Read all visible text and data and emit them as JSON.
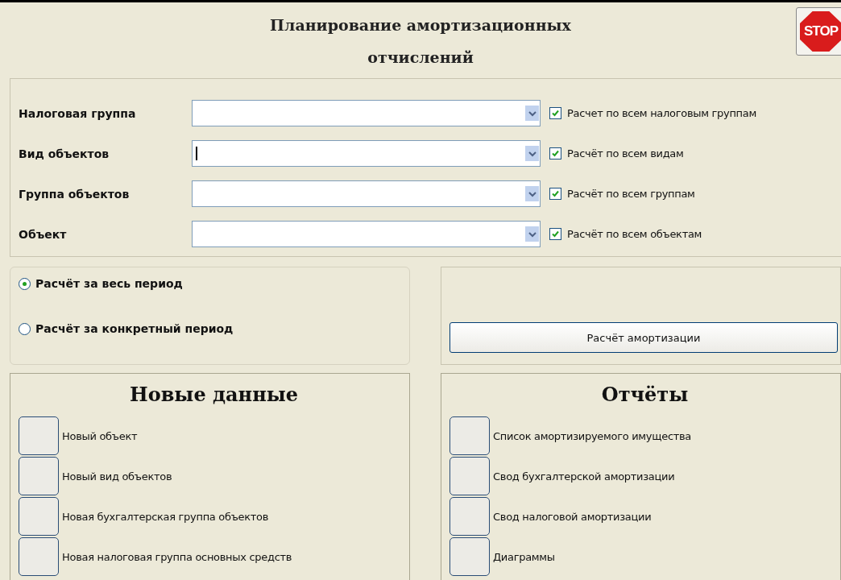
{
  "title": "Планирование амортизационных отчислений",
  "stop_button": {
    "label": "STOP"
  },
  "filters": [
    {
      "label": "Налоговая группа",
      "focused": false,
      "all_label": "Расчет по всем налоговым группам",
      "all_checked": true
    },
    {
      "label": "Вид объектов",
      "focused": true,
      "all_label": "Расчёт по всем видам",
      "all_checked": true
    },
    {
      "label": "Группа объектов",
      "focused": false,
      "all_label": "Расчёт по всем группам",
      "all_checked": true
    },
    {
      "label": "Объект",
      "focused": false,
      "all_label": "Расчёт по всем объектам",
      "all_checked": true
    }
  ],
  "period_options": [
    {
      "label": "Расчёт за весь период",
      "selected": true
    },
    {
      "label": "Расчёт за конкретный период",
      "selected": false
    }
  ],
  "calculate_button": {
    "label": "Расчёт амортизации"
  },
  "new_data": {
    "heading": "Новые данные",
    "items": [
      "Новый объект",
      "Новый вид объектов",
      "Новая бухгалтерская группа объектов",
      "Новая налоговая группа основных средств"
    ]
  },
  "reports": {
    "heading": "Отчёты",
    "items": [
      "Список амортизируемого имущества",
      "Свод бухгалтерской амортизации",
      "Свод налоговой амортизации",
      "Диаграммы"
    ]
  }
}
